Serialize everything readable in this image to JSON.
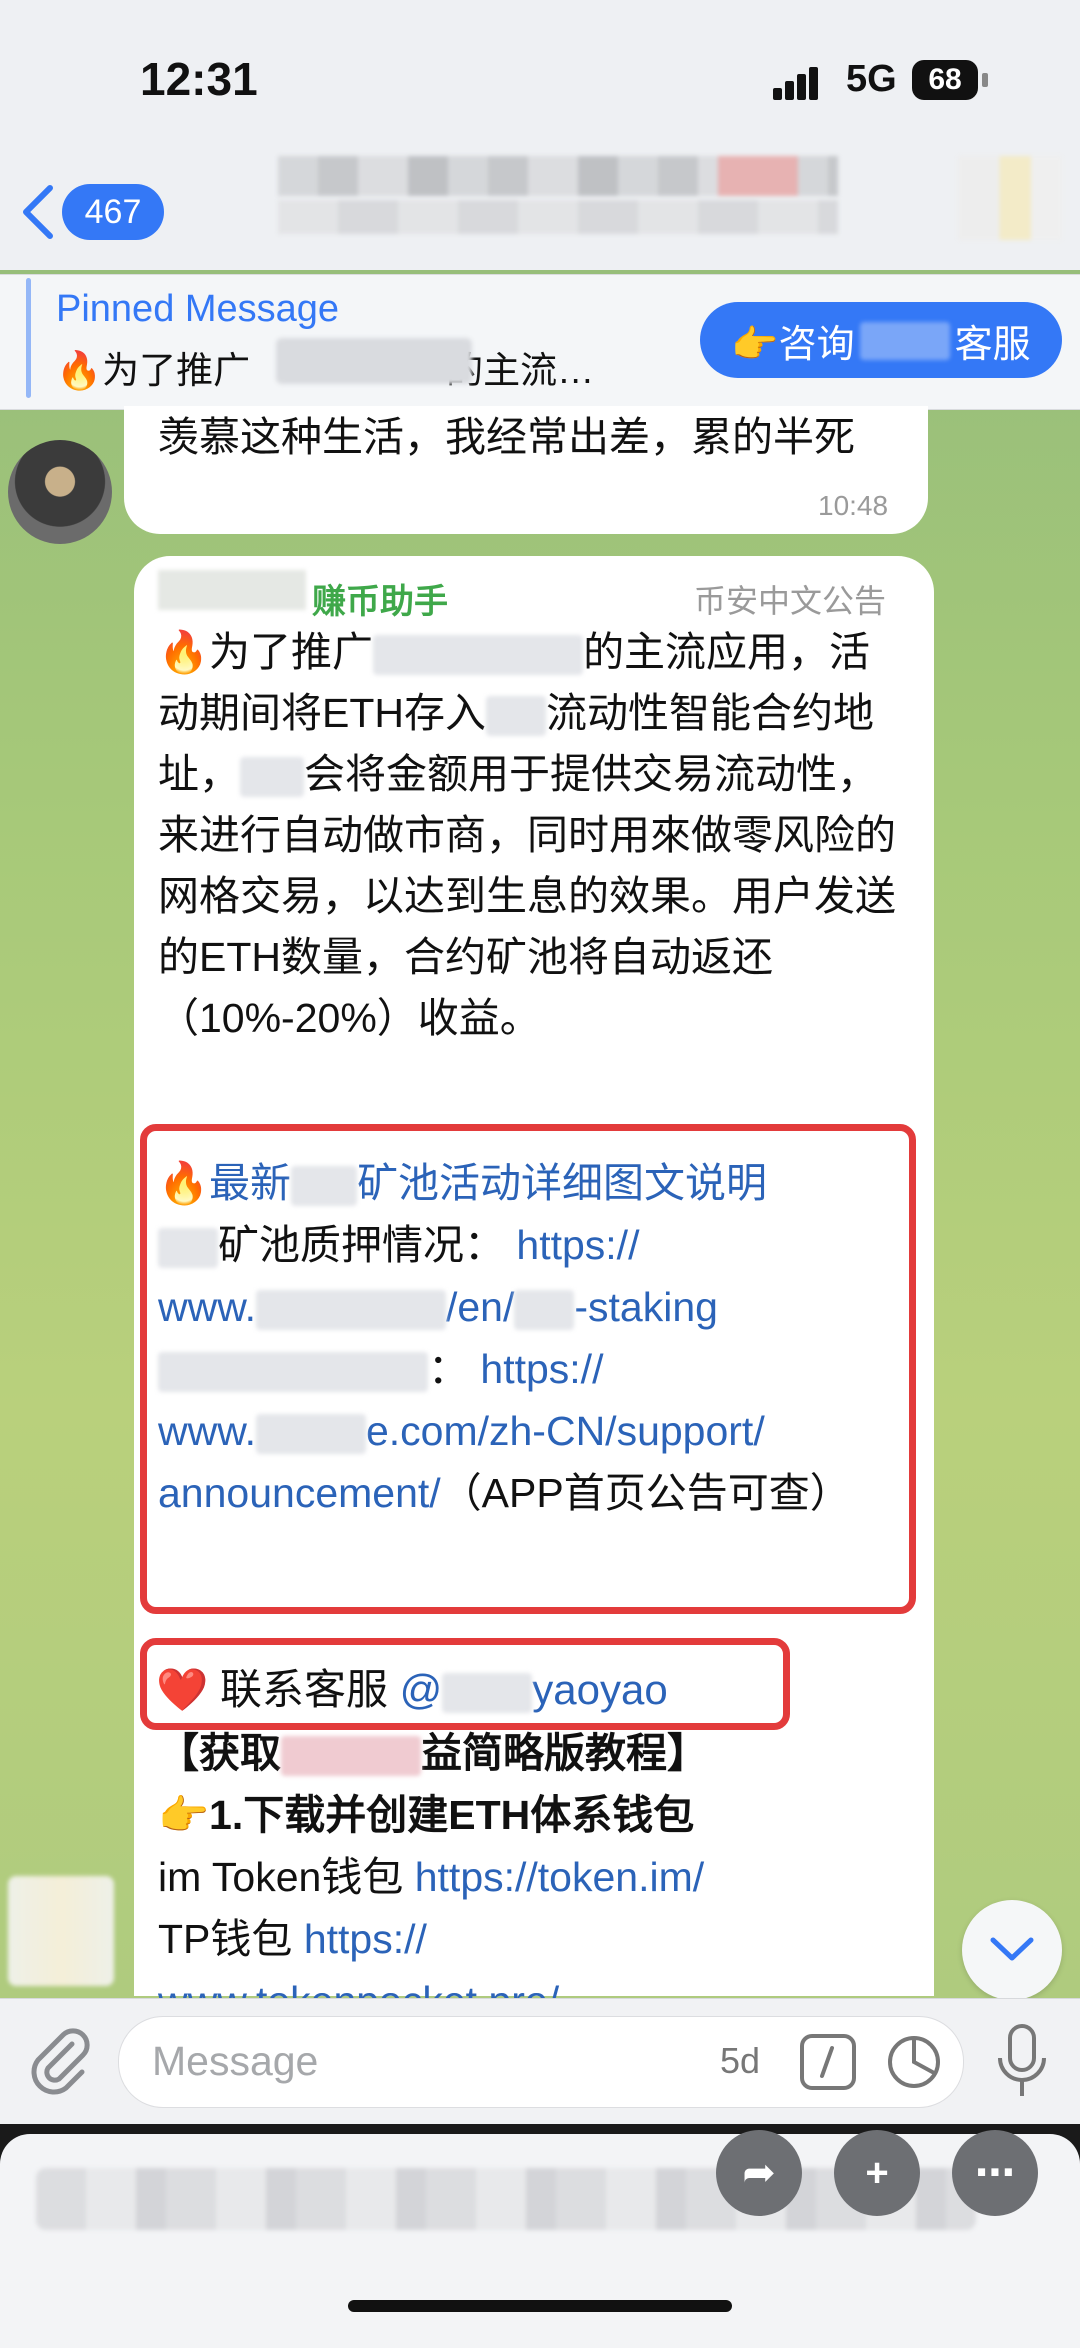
{
  "status_bar": {
    "time": "12:31",
    "network": "5G",
    "battery": "68"
  },
  "header": {
    "unread_count": "467"
  },
  "pinned": {
    "title": "Pinned Message",
    "preview_prefix": "🔥为了推广",
    "preview_suffix": "的主流…",
    "consult_prefix": "👉咨询",
    "consult_suffix": "客服"
  },
  "previous_message": {
    "text": "羡慕这种生活，我经常出差，累的半死",
    "time": "10:48"
  },
  "main_message": {
    "sender_name": "赚币助手",
    "sender_badge": "币安中文公告",
    "body_1": "🔥为了推广",
    "body_2": "的主流应用，活动期间将ETH存入",
    "body_3": "流动性智能合约地址，",
    "body_4": "会将金额用于提供交易流动性，来进行自动做市商，同时用來做零风险的网格交易，以达到生息的效果。用户发送的ETH数量，合约矿池将自动返还（10%-20%）收益。",
    "link_title_prefix": "🔥最新",
    "link_title_suffix": "矿池活动详细图文说明",
    "pledge_label": "矿池质押情况：",
    "link1_a": "https://",
    "link1_b": "www.",
    "link1_c": "/en/",
    "link1_d": "-staking",
    "link2_label": "：",
    "link2_a": "https://",
    "link2_b": "www.",
    "link2_c": "e.com/zh-CN/support/",
    "link2_d": "announcement/",
    "link2_note": "（APP首页公告可查）",
    "contact_prefix": "❤️ 联系客服",
    "contact_handle_a": "@",
    "contact_handle_b": "yaoyao",
    "tutorial_title_a": "【获取",
    "tutorial_title_b": "益简略版教程】",
    "step1": "👉1.下载并创建ETH体系钱包",
    "imtoken_label": "im Token钱包",
    "imtoken_url": "https://token.im/",
    "tp_label": "TP钱包",
    "tp_url_a": "https://",
    "tp_url_b": "www.tokenpocket.pro/"
  },
  "composer": {
    "placeholder": "Message",
    "timer": "5d"
  },
  "icons": [
    "back-chevron-icon",
    "signal-icon",
    "attach-icon",
    "command-icon",
    "sticker-icon",
    "mic-icon",
    "chevron-down-icon",
    "share-icon",
    "add-icon",
    "more-icon"
  ]
}
